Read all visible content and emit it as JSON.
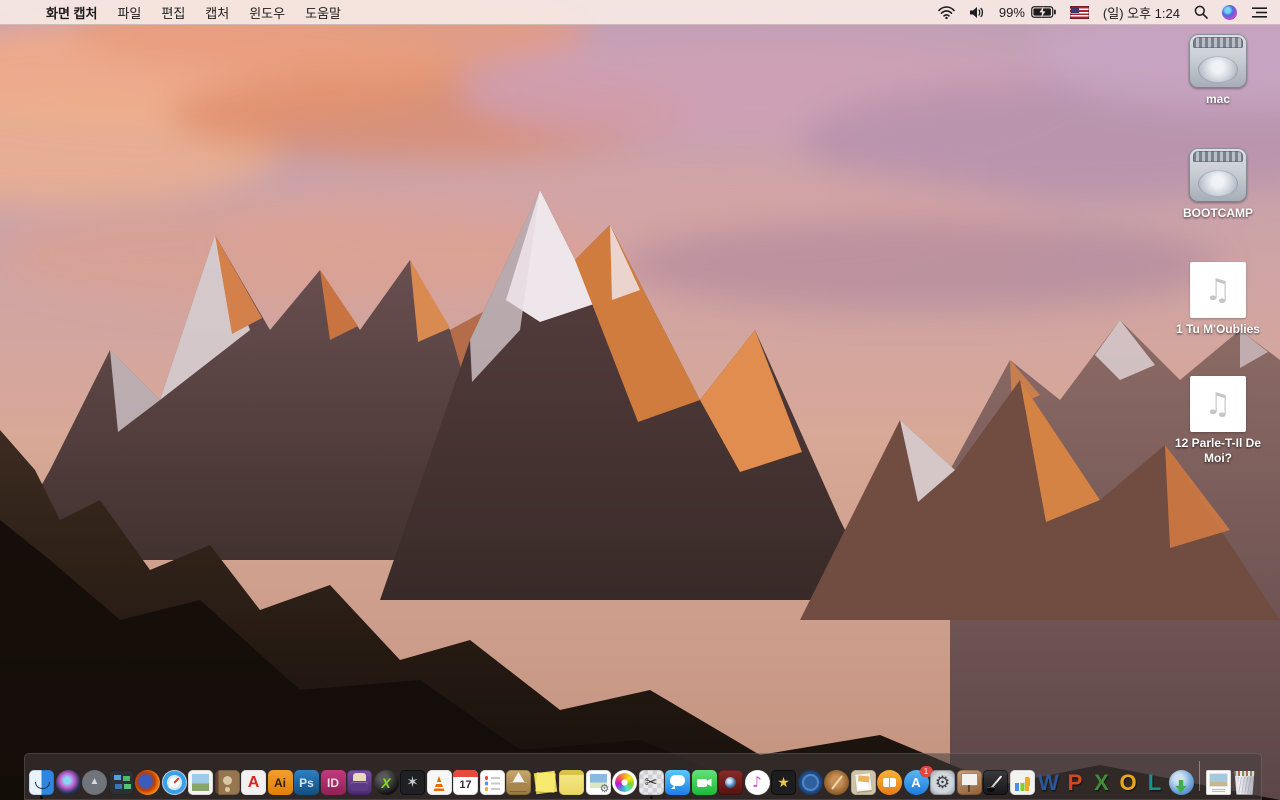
{
  "menu_bar": {
    "apple_logo": "",
    "app_name": "화면 캡처",
    "menus": [
      "파일",
      "편집",
      "캡처",
      "윈도우",
      "도움말"
    ],
    "status": {
      "battery_percent": "99%",
      "battery_charging": true,
      "clock": "(일) 오후 1:24",
      "input_source": "us-flag"
    },
    "status_icons": [
      "wifi-icon",
      "volume-icon",
      "battery-icon",
      "input-flag",
      "clock",
      "spotlight-icon",
      "siri-icon",
      "notification-center-icon"
    ]
  },
  "desktop": {
    "wallpaper": "sierra-mountain-sunset",
    "icons": [
      {
        "name": "mac-drive",
        "label": "mac",
        "type": "hard-drive"
      },
      {
        "name": "bootcamp-drive",
        "label": "BOOTCAMP",
        "type": "hard-drive"
      },
      {
        "name": "audio-file-1",
        "label": "1 Tu M'Oublies",
        "type": "audio-file"
      },
      {
        "name": "audio-file-12",
        "label": "12 Parle-T-Il De Moi?",
        "type": "audio-file"
      }
    ],
    "audio_note_glyph": "♫"
  },
  "dock": {
    "bg_color": "rgba(70,62,62,0.55)",
    "badge_color": "#e8453a",
    "items": [
      {
        "name": "finder",
        "kind": "finder",
        "running": true
      },
      {
        "name": "siri",
        "kind": "siri"
      },
      {
        "name": "launchpad",
        "kind": "launchpad"
      },
      {
        "name": "mission-control",
        "kind": "missionctl"
      },
      {
        "name": "firefox",
        "kind": "firefox"
      },
      {
        "name": "safari",
        "kind": "safari"
      },
      {
        "name": "preview",
        "kind": "preview"
      },
      {
        "name": "contacts",
        "kind": "contacts"
      },
      {
        "name": "acrobat-reader",
        "kind": "acrobat",
        "glyph": "A"
      },
      {
        "name": "illustrator",
        "kind": "ai",
        "glyph": "Ai"
      },
      {
        "name": "photoshop",
        "kind": "ps",
        "glyph": "Ps"
      },
      {
        "name": "indesign",
        "kind": "id",
        "glyph": "ID"
      },
      {
        "name": "toast-titanium",
        "kind": "toast"
      },
      {
        "name": "x-sphere-app",
        "kind": "xsphere",
        "glyph": "X"
      },
      {
        "name": "fan-utility-app",
        "kind": "fanapp",
        "glyph": "✶"
      },
      {
        "name": "vlc",
        "kind": "vlc"
      },
      {
        "name": "calendar",
        "kind": "calendar",
        "glyph": "17"
      },
      {
        "name": "reminders",
        "kind": "reminders"
      },
      {
        "name": "stuffit-expander",
        "kind": "stuffit"
      },
      {
        "name": "stickies",
        "kind": "stickies"
      },
      {
        "name": "notepad-app",
        "kind": "notepad"
      },
      {
        "name": "image-capture",
        "kind": "geardoc"
      },
      {
        "name": "photos",
        "kind": "photos"
      },
      {
        "name": "screen-capture-grab",
        "kind": "grab",
        "glyph": "✂",
        "running": true
      },
      {
        "name": "messages",
        "kind": "messages"
      },
      {
        "name": "facetime",
        "kind": "facetime"
      },
      {
        "name": "photo-booth",
        "kind": "photobooth"
      },
      {
        "name": "itunes",
        "kind": "itunes",
        "glyph": "♪"
      },
      {
        "name": "imovie",
        "kind": "imovie",
        "glyph": "★"
      },
      {
        "name": "idvd",
        "kind": "idvd"
      },
      {
        "name": "garageband",
        "kind": "garageband"
      },
      {
        "name": "clippings-app",
        "kind": "clippings"
      },
      {
        "name": "ibooks",
        "kind": "ibooks"
      },
      {
        "name": "app-store",
        "kind": "appstore",
        "glyph": "A",
        "badge": "1"
      },
      {
        "name": "system-preferences",
        "kind": "sysprefs"
      },
      {
        "name": "keynote-09",
        "kind": "keynote09"
      },
      {
        "name": "pages-09",
        "kind": "pages09"
      },
      {
        "name": "numbers-09",
        "kind": "numbers09"
      },
      {
        "name": "ms-word",
        "kind": "word",
        "glyph": "W"
      },
      {
        "name": "ms-powerpoint",
        "kind": "ppt",
        "glyph": "P"
      },
      {
        "name": "ms-excel",
        "kind": "excel",
        "glyph": "X"
      },
      {
        "name": "ms-outlook",
        "kind": "outlook",
        "glyph": "O"
      },
      {
        "name": "ms-lync",
        "kind": "lync",
        "glyph": "L"
      },
      {
        "name": "download-manager",
        "kind": "downloader"
      },
      {
        "name": "separator",
        "kind": "separator"
      },
      {
        "name": "document-file",
        "kind": "filedoc"
      },
      {
        "name": "trash-full",
        "kind": "trash"
      }
    ]
  }
}
